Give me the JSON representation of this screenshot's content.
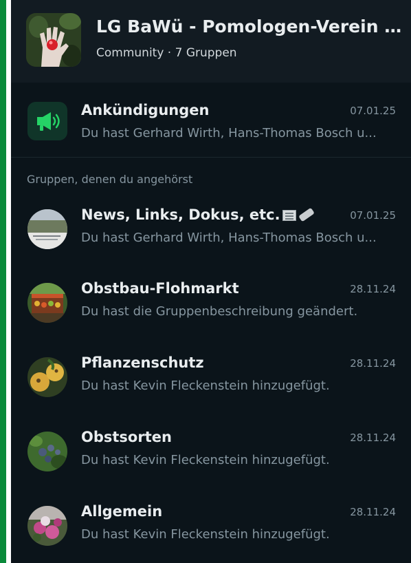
{
  "community": {
    "title": "LG BaWü - Pomologen-Verein e...",
    "subtitle": "Community · 7 Gruppen",
    "avatar_icon": "hand-with-berry-photo"
  },
  "announcements": {
    "icon": "megaphone-icon",
    "title": "Ankündigungen",
    "date": "07.01.25",
    "preview": "Du hast Gerhard Wirth, Hans-Thomas Bosch u..."
  },
  "section_label": "Gruppen, denen du angehörst",
  "groups": [
    {
      "title": "News, Links, Dokus, etc.",
      "date": "07.01.25",
      "preview": "Du hast Gerhard Wirth, Hans-Thomas Bosch u...",
      "emojis": [
        "newspaper-icon",
        "pencil-icon"
      ]
    },
    {
      "title": "Obstbau-Flohmarkt",
      "date": "28.11.24",
      "preview": "Du hast die Gruppenbeschreibung geändert."
    },
    {
      "title": "Pflanzenschutz",
      "date": "28.11.24",
      "preview": "Du hast Kevin Fleckenstein hinzugefügt."
    },
    {
      "title": "Obstsorten",
      "date": "28.11.24",
      "preview": "Du hast Kevin Fleckenstein hinzugefügt."
    },
    {
      "title": "Allgemein",
      "date": "28.11.24",
      "preview": "Du hast Kevin Fleckenstein hinzugefügt."
    }
  ],
  "colors": {
    "background": "#0b141a",
    "header": "#121b22",
    "accent_green": "#0a8a3a",
    "primary_text": "#e9edef",
    "secondary_text": "#8696a0"
  }
}
